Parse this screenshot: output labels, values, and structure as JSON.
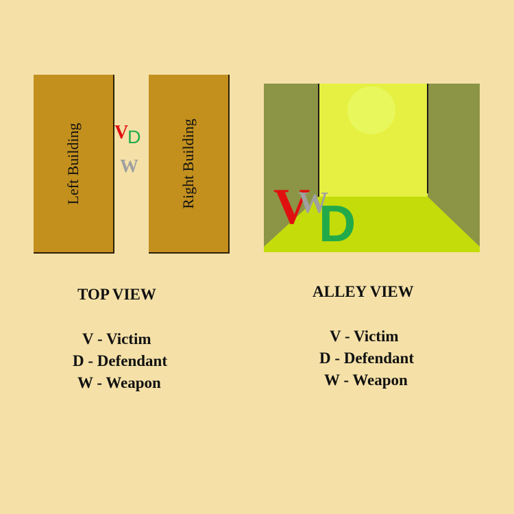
{
  "top_view": {
    "left_building_label": "Left Building",
    "right_building_label": "Right Building",
    "markers": {
      "victim": "V",
      "defendant": "D",
      "weapon": "W"
    },
    "heading": "TOP VIEW",
    "legend": [
      "V - Victim",
      "D - Defendant",
      "W - Weapon"
    ]
  },
  "alley_view": {
    "markers": {
      "victim": "V",
      "defendant": "D",
      "weapon": "W"
    },
    "heading": "ALLEY VIEW",
    "legend": [
      "V - Victim",
      "D - Defendant",
      "W - Weapon"
    ]
  },
  "colors": {
    "background": "#f5e1a8",
    "building": "#c3901e",
    "alley_wall": "#8c9445",
    "alley_ground": "#c4dc0a",
    "sky": "#e6f042",
    "sun": "#e8f75c",
    "victim": "#e01010",
    "defendant": "#22aa4a",
    "weapon": "#a0a0a0"
  }
}
